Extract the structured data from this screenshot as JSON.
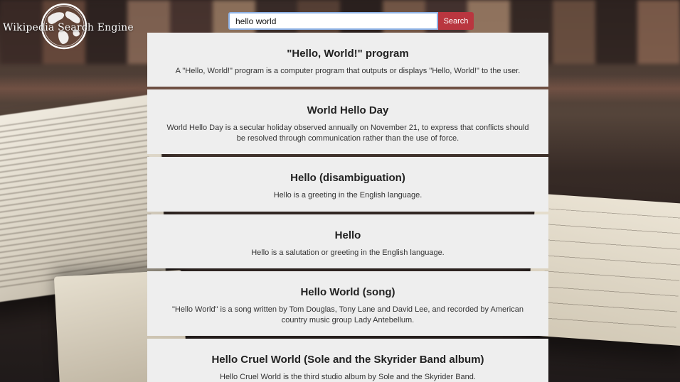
{
  "logo": {
    "text": "Wikipedia Search Engine",
    "icon": "globe-icon"
  },
  "search": {
    "value": "hello world",
    "button_label": "Search"
  },
  "results": [
    {
      "title": "\"Hello, World!\" program",
      "description": "A \"Hello, World!\" program is a computer program that outputs or displays \"Hello, World!\" to the user."
    },
    {
      "title": "World Hello Day",
      "description": "World Hello Day is a secular holiday observed annually on November 21, to express that conflicts should be resolved through communication rather than the use of force."
    },
    {
      "title": "Hello (disambiguation)",
      "description": "Hello is a greeting in the English language."
    },
    {
      "title": "Hello",
      "description": "Hello is a salutation or greeting in the English language."
    },
    {
      "title": "Hello World (song)",
      "description": "\"Hello World\" is a song written by Tom Douglas, Tony Lane and David Lee, and recorded by American country music group Lady Antebellum."
    },
    {
      "title": "Hello Cruel World (Sole and the Skyrider Band album)",
      "description": "Hello Cruel World is the third studio album by Sole and the Skyrider Band."
    }
  ],
  "colors": {
    "search_button": "#b9363f",
    "input_border": "#8fb3e6",
    "card_background": "#eeeeee"
  }
}
